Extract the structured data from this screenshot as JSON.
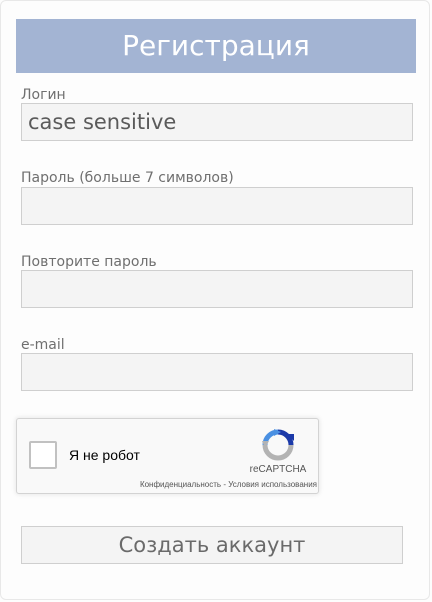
{
  "header": {
    "title": "Регистрация"
  },
  "form": {
    "login": {
      "label": "Логин",
      "value": "case sensitive",
      "placeholder": ""
    },
    "password": {
      "label": "Пароль (больше 7 символов)",
      "value": ""
    },
    "password_repeat": {
      "label": "Повторите пароль",
      "value": ""
    },
    "email": {
      "label": "e-mail",
      "value": ""
    },
    "submit_label": "Создать аккаунт"
  },
  "recaptcha": {
    "label": "Я не робот",
    "brand": "reCAPTCHA",
    "privacy_link": "Конфиденциальность",
    "separator": " - ",
    "terms_link": "Условия использования",
    "checked": false,
    "logo_icon": "recaptcha-logo-icon",
    "colors": {
      "blue": "#4a90e2",
      "dark_blue": "#1c3aa9",
      "grey": "#b3b3b3"
    }
  },
  "colors": {
    "header_bg": "#a3b4d3",
    "field_bg": "#f4f4f4",
    "field_border": "#cfcfcf"
  }
}
